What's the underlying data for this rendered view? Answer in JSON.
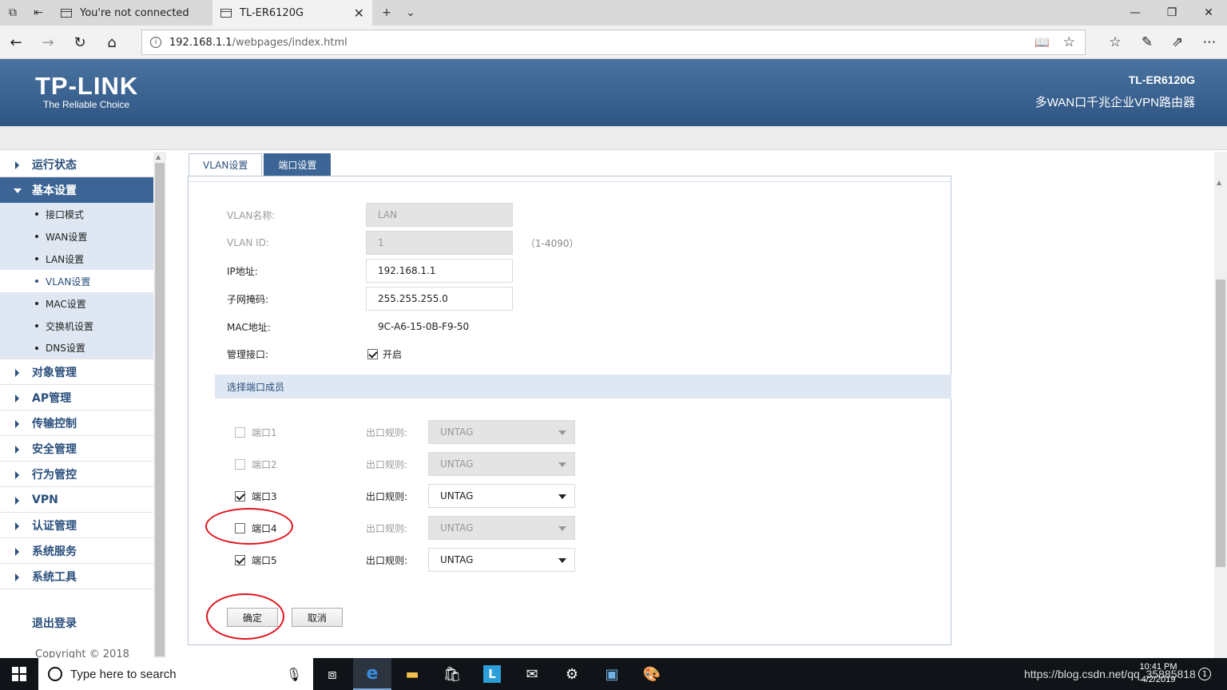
{
  "browser": {
    "tabs": [
      {
        "label": "You're not connected"
      },
      {
        "label": "TL-ER6120G"
      }
    ],
    "url_host": "192.168.1.1",
    "url_path": "/webpages/index.html"
  },
  "header": {
    "logo": "TP-LINK",
    "slogan": "The Reliable Choice",
    "model": "TL-ER6120G",
    "description": "多WAN口千兆企业VPN路由器"
  },
  "sidebar": {
    "items": [
      {
        "label": "运行状态"
      },
      {
        "label": "基本设置",
        "expanded": true,
        "children": [
          {
            "label": "接口模式"
          },
          {
            "label": "WAN设置"
          },
          {
            "label": "LAN设置"
          },
          {
            "label": "VLAN设置",
            "current": true
          },
          {
            "label": "MAC设置"
          },
          {
            "label": "交换机设置"
          },
          {
            "label": "DNS设置"
          }
        ]
      },
      {
        "label": "对象管理"
      },
      {
        "label": "AP管理"
      },
      {
        "label": "传输控制"
      },
      {
        "label": "安全管理"
      },
      {
        "label": "行为管控"
      },
      {
        "label": "VPN"
      },
      {
        "label": "认证管理"
      },
      {
        "label": "系统服务"
      },
      {
        "label": "系统工具"
      }
    ],
    "logout": "退出登录",
    "copyright": "Copyright © 2018"
  },
  "main": {
    "tabs": [
      {
        "label": "VLAN设置"
      },
      {
        "label": "端口设置",
        "active": true
      }
    ],
    "form": {
      "vlan_name_label": "VLAN名称:",
      "vlan_name_value": "LAN",
      "vlan_id_label": "VLAN ID:",
      "vlan_id_value": "1",
      "vlan_id_hint": "（1-4090）",
      "ip_label": "IP地址:",
      "ip_value": "192.168.1.1",
      "mask_label": "子网掩码:",
      "mask_value": "255.255.255.0",
      "mac_label": "MAC地址:",
      "mac_value": "9C-A6-15-0B-F9-50",
      "mgmt_label": "管理接口:",
      "mgmt_option": "开启",
      "mgmt_checked": true
    },
    "section_title": "选择端口成员",
    "rule_label": "出口规则:",
    "ports": [
      {
        "name": "端口1",
        "checked": false,
        "disabled": true,
        "rule": "UNTAG"
      },
      {
        "name": "端口2",
        "checked": false,
        "disabled": true,
        "rule": "UNTAG"
      },
      {
        "name": "端口3",
        "checked": true,
        "disabled": false,
        "rule": "UNTAG"
      },
      {
        "name": "端口4",
        "checked": false,
        "disabled": false,
        "rule": "UNTAG"
      },
      {
        "name": "端口5",
        "checked": true,
        "disabled": false,
        "rule": "UNTAG"
      }
    ],
    "confirm_label": "确定",
    "cancel_label": "取消"
  },
  "taskbar": {
    "search_placeholder": "Type here to search",
    "tray_text": "https://blog.csdn.net/qq_35885818",
    "time": "10:41 PM",
    "date": "4/2/2019",
    "notifications": "1"
  },
  "colors": {
    "header_blue": "#3c6595",
    "annotation_red": "#e0141e"
  }
}
